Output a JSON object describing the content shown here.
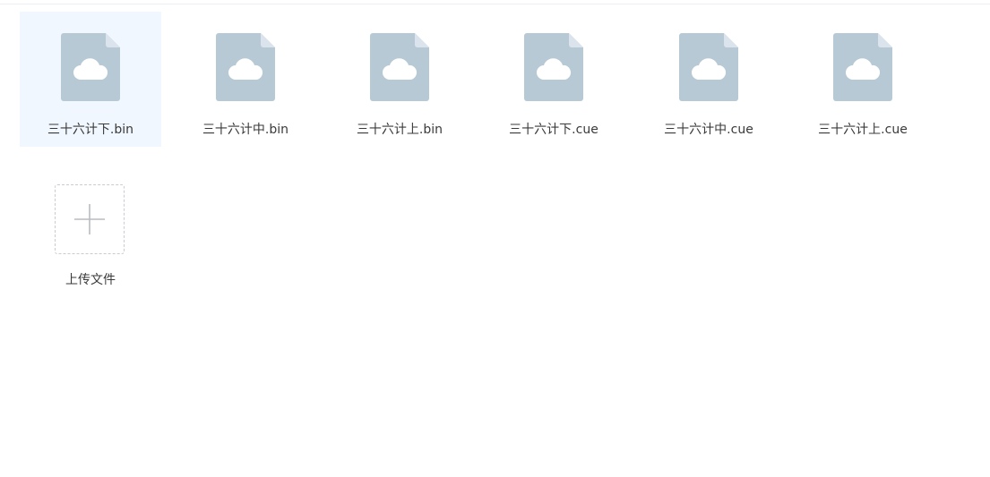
{
  "files": [
    {
      "name": "三十六计下.bin",
      "icon": "cloud-file-icon",
      "selected": true
    },
    {
      "name": "三十六计中.bin",
      "icon": "cloud-file-icon",
      "selected": false
    },
    {
      "name": "三十六计上.bin",
      "icon": "cloud-file-icon",
      "selected": false
    },
    {
      "name": "三十六计下.cue",
      "icon": "cloud-file-icon",
      "selected": false
    },
    {
      "name": "三十六计中.cue",
      "icon": "cloud-file-icon",
      "selected": false
    },
    {
      "name": "三十六计上.cue",
      "icon": "cloud-file-icon",
      "selected": false
    }
  ],
  "upload": {
    "label": "上传文件",
    "icon": "plus-icon"
  },
  "colors": {
    "file_icon": "#b8c9d6",
    "file_fold": "#dbe4ec",
    "selected_bg": "#f0f7fe",
    "text": "#3a3a3a",
    "upload_border": "#c8cbd0",
    "plus": "#b9bcc0"
  }
}
